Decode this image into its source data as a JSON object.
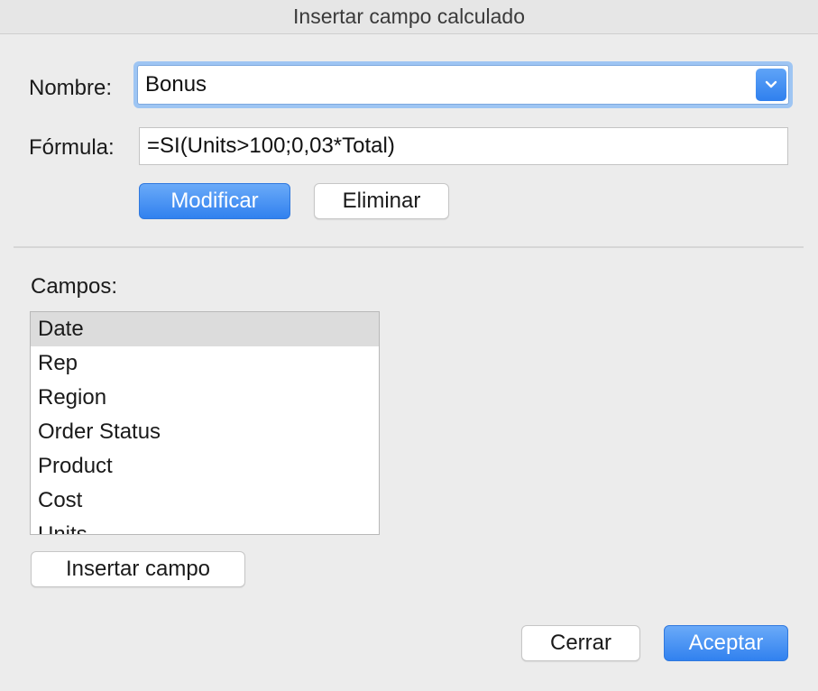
{
  "dialog": {
    "title": "Insertar campo calculado"
  },
  "form": {
    "name_label": "Nombre:",
    "name_value": "Bonus",
    "formula_label": "Fórmula:",
    "formula_value": "=SI(Units>100;0,03*Total)",
    "modify_label": "Modificar",
    "delete_label": "Eliminar"
  },
  "fields": {
    "label": "Campos:",
    "items": [
      "Date",
      "Rep",
      "Region",
      "Order Status",
      "Product",
      "Cost",
      "Units"
    ],
    "selected": "Date",
    "insert_label": "Insertar campo"
  },
  "footer": {
    "close_label": "Cerrar",
    "accept_label": "Aceptar"
  },
  "colors": {
    "accent": "#3181ef",
    "background": "#ececec",
    "selection": "#dcdcdc"
  },
  "icons": {
    "name_dropdown": "chevron-down-icon"
  }
}
